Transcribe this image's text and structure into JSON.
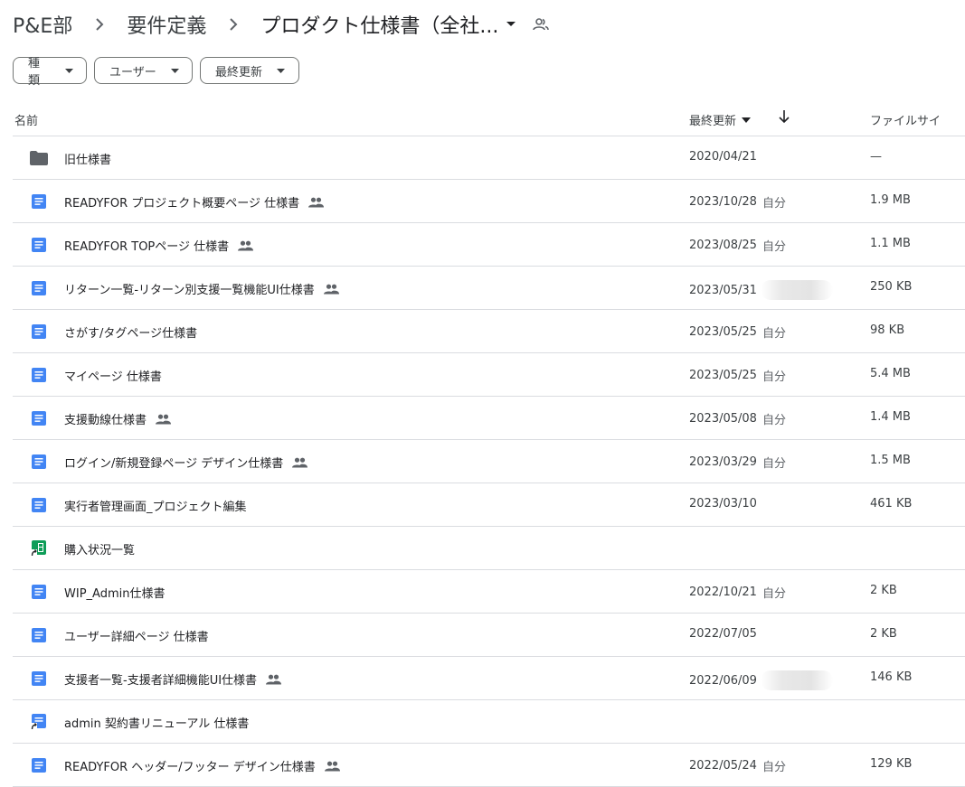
{
  "breadcrumb": {
    "items": [
      "P&E部",
      "要件定義"
    ],
    "current": "プロダクト仕様書（全社..."
  },
  "filters": [
    {
      "label": "種類"
    },
    {
      "label": "ユーザー"
    },
    {
      "label": "最終更新"
    }
  ],
  "columns": {
    "name": "名前",
    "modified": "最終更新",
    "size": "ファイルサイ"
  },
  "colors": {
    "doc": "#4285f4",
    "sheet": "#0f9d58",
    "folder": "#5f6368",
    "text": "#202124",
    "divider": "#dadce0"
  },
  "rows": [
    {
      "icon": "folder-icon",
      "name": "旧仕様書",
      "shared": false,
      "date": "2020/04/21",
      "by": "",
      "blurred": false,
      "size": "—"
    },
    {
      "icon": "doc-icon",
      "name": "READYFOR プロジェクト概要ページ 仕様書",
      "shared": true,
      "date": "2023/10/28",
      "by": "自分",
      "blurred": false,
      "size": "1.9 MB"
    },
    {
      "icon": "doc-icon",
      "name": "READYFOR TOPページ 仕様書",
      "shared": true,
      "date": "2023/08/25",
      "by": "自分",
      "blurred": false,
      "size": "1.1 MB"
    },
    {
      "icon": "doc-icon",
      "name": "リターン一覧-リターン別支援一覧機能UI仕様書",
      "shared": true,
      "date": "2023/05/31",
      "by": "",
      "blurred": true,
      "size": "250 KB"
    },
    {
      "icon": "doc-icon",
      "name": "さがす/タグページ仕様書",
      "shared": false,
      "date": "2023/05/25",
      "by": "自分",
      "blurred": false,
      "size": "98 KB"
    },
    {
      "icon": "doc-icon",
      "name": "マイページ 仕様書",
      "shared": false,
      "date": "2023/05/25",
      "by": "自分",
      "blurred": false,
      "size": "5.4 MB"
    },
    {
      "icon": "doc-icon",
      "name": "支援動線仕様書",
      "shared": true,
      "date": "2023/05/08",
      "by": "自分",
      "blurred": false,
      "size": "1.4 MB"
    },
    {
      "icon": "doc-icon",
      "name": "ログイン/新規登録ページ デザイン仕様書",
      "shared": true,
      "date": "2023/03/29",
      "by": "自分",
      "blurred": false,
      "size": "1.5 MB"
    },
    {
      "icon": "doc-icon",
      "name": "実行者管理画面_プロジェクト編集",
      "shared": false,
      "date": "2023/03/10",
      "by": "",
      "blurred": false,
      "size": "461 KB"
    },
    {
      "icon": "sheet-shortcut-icon",
      "name": "購入状況一覧",
      "shared": false,
      "date": "",
      "by": "",
      "blurred": false,
      "size": ""
    },
    {
      "icon": "doc-icon",
      "name": "WIP_Admin仕様書",
      "shared": false,
      "date": "2022/10/21",
      "by": "自分",
      "blurred": false,
      "size": "2 KB"
    },
    {
      "icon": "doc-icon",
      "name": "ユーザー詳細ページ 仕様書",
      "shared": false,
      "date": "2022/07/05",
      "by": "",
      "blurred": false,
      "size": "2 KB"
    },
    {
      "icon": "doc-icon",
      "name": "支援者一覧-支援者詳細機能UI仕様書",
      "shared": true,
      "date": "2022/06/09",
      "by": "",
      "blurred": true,
      "size": "146 KB"
    },
    {
      "icon": "doc-shortcut-icon",
      "name": "admin 契約書リニューアル 仕様書",
      "shared": false,
      "date": "",
      "by": "",
      "blurred": false,
      "size": ""
    },
    {
      "icon": "doc-icon",
      "name": "READYFOR ヘッダー/フッター デザイン仕様書",
      "shared": true,
      "date": "2022/05/24",
      "by": "自分",
      "blurred": false,
      "size": "129 KB"
    }
  ]
}
